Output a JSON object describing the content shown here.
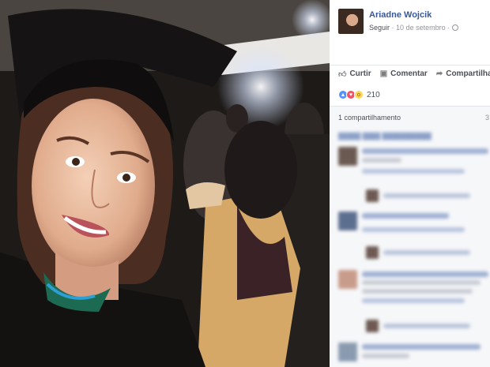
{
  "post": {
    "author": "Ariadne Wojcik",
    "follow": "Seguir",
    "date": "10 de setembro",
    "separator": "·",
    "privacy_icon": "globe-icon"
  },
  "actions": {
    "like": {
      "label": "Curtir",
      "icon": "thumbs-up-icon"
    },
    "comment": {
      "label": "Comentar",
      "icon": "speech-bubble-icon"
    },
    "share": {
      "label": "Compartilhar",
      "icon": "share-arrow-icon"
    }
  },
  "reactions": {
    "icons": [
      "like-reaction-icon",
      "love-reaction-icon",
      "wow-reaction-icon"
    ],
    "count": "210"
  },
  "shares": {
    "label": "1 compartilhamento",
    "right_count": "3"
  },
  "comments": {
    "blurred": true,
    "count_visible": 5
  },
  "photo": {
    "description_icon": "photo"
  },
  "colors": {
    "link_blue": "#365899",
    "meta_gray": "#90949c",
    "like_blue": "#5890ff",
    "love_red": "#f25268",
    "wow_yellow": "#fcd75b"
  }
}
